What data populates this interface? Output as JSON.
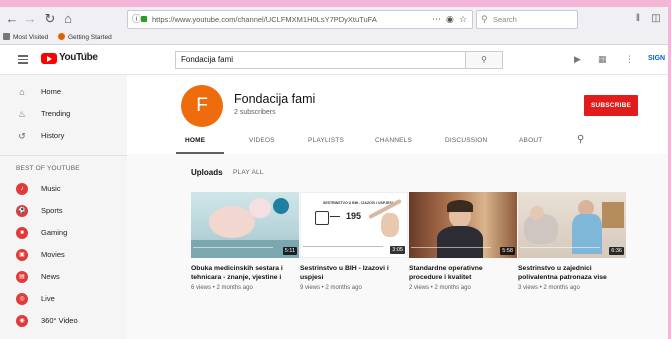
{
  "browser": {
    "url": "https://www.youtube.com/channel/UCLFMXM1H0LsY7PDyXtuTuFA",
    "search_placeholder": "Search",
    "bookmarks": [
      "Most Visited",
      "Getting Started"
    ]
  },
  "header": {
    "logo_text": "YouTube",
    "logo_region": "BA",
    "search_value": "Fondacija fami",
    "signin_label": "SIGN"
  },
  "sidebar": {
    "items": [
      {
        "label": "Home",
        "icon": "home-icon"
      },
      {
        "label": "Trending",
        "icon": "flame-icon"
      },
      {
        "label": "History",
        "icon": "history-icon"
      }
    ],
    "section_title": "BEST OF YOUTUBE",
    "best_of": [
      {
        "label": "Music",
        "icon": "music-icon"
      },
      {
        "label": "Sports",
        "icon": "sports-icon"
      },
      {
        "label": "Gaming",
        "icon": "gaming-icon"
      },
      {
        "label": "Movies",
        "icon": "movies-icon"
      },
      {
        "label": "News",
        "icon": "news-icon"
      },
      {
        "label": "Live",
        "icon": "live-icon"
      },
      {
        "label": "360° Video",
        "icon": "360-video-icon"
      }
    ]
  },
  "channel": {
    "avatar_letter": "F",
    "name": "Fondacija fami",
    "subscribers": "2 subscribers",
    "subscribe_label": "SUBSCRIBE",
    "tabs": [
      "HOME",
      "VIDEOS",
      "PLAYLISTS",
      "CHANNELS",
      "DISCUSSION",
      "ABOUT"
    ],
    "active_tab": "HOME"
  },
  "uploads": {
    "title": "Uploads",
    "play_all": "PLAY ALL",
    "videos": [
      {
        "title": "Obuka medicinskih sestara i tehnicara - znanje, vjestine i",
        "meta": "6 views • 2 months ago",
        "duration": "5:11"
      },
      {
        "title": "Sestrinstvo u BIH - Izazovi i uspjesi",
        "meta": "9 views • 2 months ago",
        "duration": "3:05",
        "board_heading": "SESTRINSTVO U BIH - IZAZOVI I USPJESI",
        "board_number": "195"
      },
      {
        "title": "Standardne operativne procedure i kvalitet",
        "meta": "2 views • 2 months ago",
        "duration": "5:58"
      },
      {
        "title": "Sestrinstvo u zajednici polivalentna patronaza vise",
        "meta": "3 views • 2 months ago",
        "duration": "6:36"
      }
    ]
  },
  "colors": {
    "brand_red": "#ff0000",
    "subscribe_red": "#e21b1b",
    "avatar_orange": "#ef6c0c",
    "frame_pink": "#f4b6d7"
  }
}
